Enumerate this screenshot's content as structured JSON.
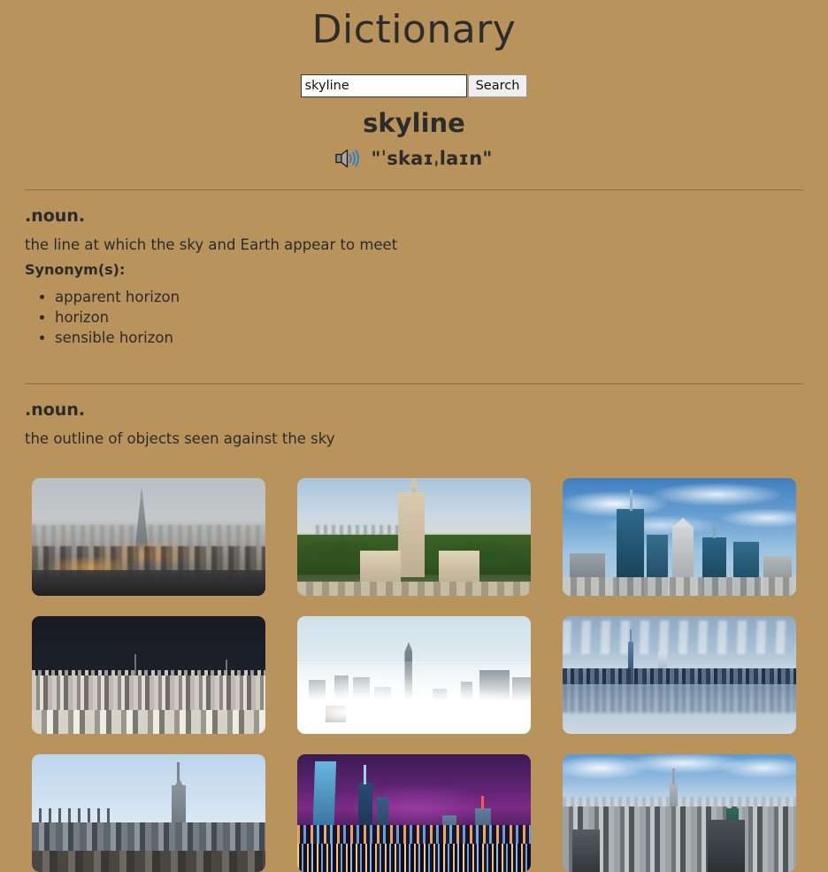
{
  "header": {
    "title": "Dictionary"
  },
  "search": {
    "value": "skyline",
    "placeholder": "",
    "button_label": "Search"
  },
  "entry": {
    "headword": "skyline",
    "pronunciation": "\"ˈskaɪˌlaɪn\"",
    "speaker_icon": "speaker-icon",
    "senses": [
      {
        "part_of_speech": ".noun.",
        "definition": "the line at which the sky and Earth appear to meet",
        "synonyms_label": "Synonym(s):",
        "synonyms": [
          "apparent horizon",
          "horizon",
          "sensible horizon"
        ]
      },
      {
        "part_of_speech": ".noun.",
        "definition": "the outline of objects seen against the sky",
        "synonyms_label": "",
        "synonyms": []
      }
    ]
  },
  "images": [
    {
      "alt": "foggy city skyline at dusk with tall pointed tower and orange street lights"
    },
    {
      "alt": "tall spired university building above green forest and distant hazy city"
    },
    {
      "alt": "blue glass skyscrapers under a bright cloudy blue sky"
    },
    {
      "alt": "dense bright cityscape under a very dark storm sky"
    },
    {
      "alt": "skyscraper tops emerging from a thick sea of white clouds"
    },
    {
      "alt": "blue city skyline mirrored on calm water"
    },
    {
      "alt": "city skyline with tall spired tower against a clear pale blue sky"
    },
    {
      "alt": "night skyline with purple sky and colorful neon lit towers"
    },
    {
      "alt": "aerial view of a dense city with a tall spired tower and blue sky"
    }
  ],
  "colors": {
    "background": "#b8935b",
    "text": "#2b2b2b",
    "divider": "#8a6d3f",
    "input_background": "#ffffff",
    "button_background": "#efefef"
  }
}
